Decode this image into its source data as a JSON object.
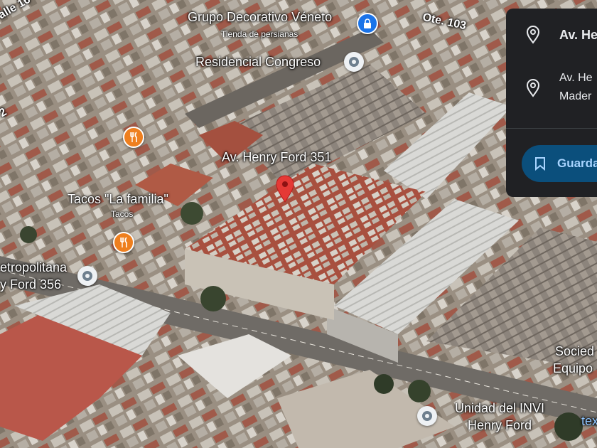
{
  "map": {
    "places": {
      "grupo_decorativo": {
        "name": "Grupo Decorativo Véneto",
        "category": "Tienda de persianas"
      },
      "residencial_congreso": {
        "name": "Residencial Congreso"
      },
      "selected_address": {
        "name": "Av. Henry Ford 351"
      },
      "tacos_familia": {
        "name": "Tacos \"La familia\"",
        "category": "Tacos"
      },
      "metropolitana": {
        "line1": "etropolitana",
        "line2": "y Ford 356"
      },
      "unidad_invi": {
        "line1": "Unidad del INVI",
        "line2": "Henry Ford"
      },
      "sociedad": {
        "line1": "Socied",
        "line2": "Equipo"
      }
    },
    "roads": {
      "ote_103": "Ote. 103",
      "calle_top_left": "alle 16",
      "left_edge_number": "2"
    },
    "fragment": "tex",
    "colors": {
      "selected_pin": "#e53935",
      "food_pin": "#ee7f1f",
      "shop_pin": "#1a73e8",
      "place_pin": "#6e7f8e"
    }
  },
  "panel": {
    "address_short": "Av. He",
    "address_full_line1": "Av. He",
    "address_full_line2": "Mader",
    "save_label": "Guarda"
  }
}
